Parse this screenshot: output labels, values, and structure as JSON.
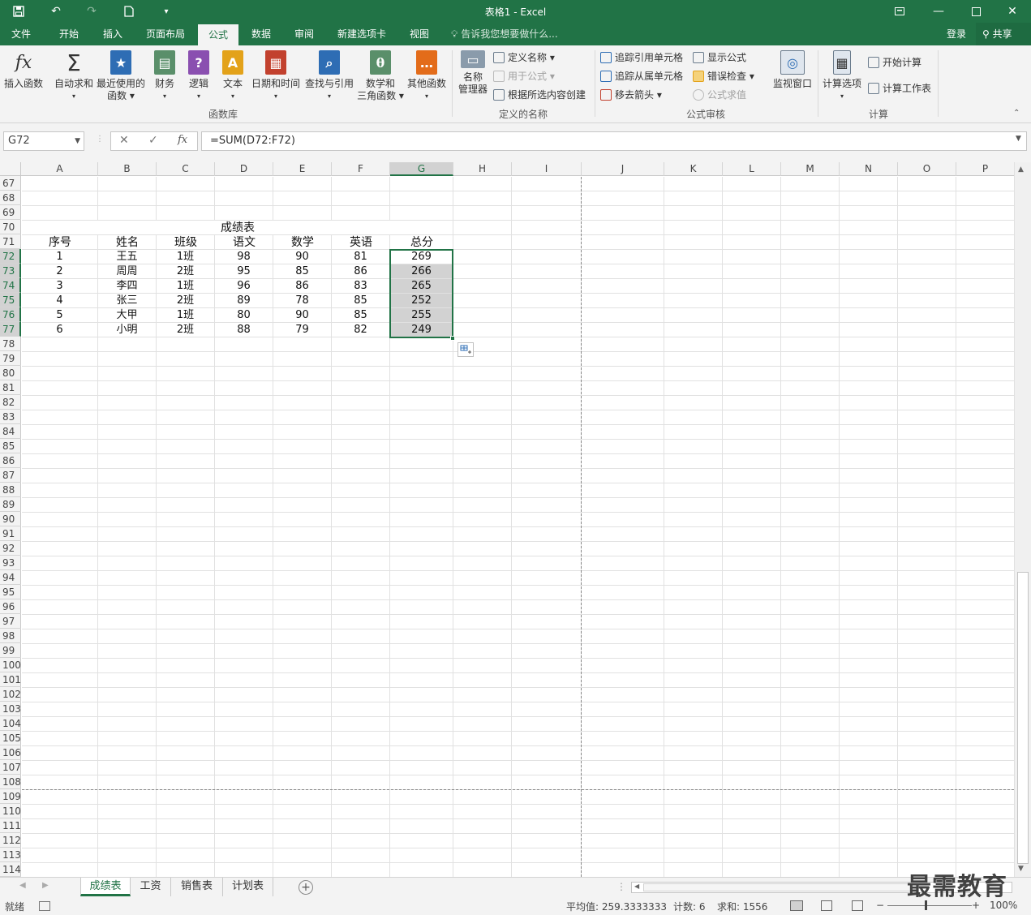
{
  "titlebar": {
    "title": "表格1 - Excel",
    "save_icon": "save-icon",
    "undo_icon": "undo-icon",
    "redo_icon": "redo-icon",
    "new_icon": "new-file-icon"
  },
  "menu": {
    "tabs": [
      "文件",
      "开始",
      "插入",
      "页面布局",
      "公式",
      "数据",
      "审阅",
      "新建选项卡",
      "视图"
    ],
    "active": "公式",
    "tell_me": "告诉我您想要做什么...",
    "login": "登录",
    "share": "共享"
  },
  "ribbon": {
    "insert_function": "插入函数",
    "autosum": "自动求和",
    "recent_1": "最近使用的",
    "recent_2": "函数",
    "financial": "财务",
    "logical": "逻辑",
    "text": "文本",
    "datetime": "日期和时间",
    "lookup": "查找与引用",
    "math_1": "数学和",
    "math_2": "三角函数",
    "more": "其他函数",
    "group_library": "函数库",
    "name_mgr_1": "名称",
    "name_mgr_2": "管理器",
    "define_name": "定义名称",
    "use_in_formula": "用于公式",
    "create_from_sel": "根据所选内容创建",
    "group_names": "定义的名称",
    "trace_precedents": "追踪引用单元格",
    "trace_dependents": "追踪从属单元格",
    "remove_arrows": "移去箭头",
    "show_formulas": "显示公式",
    "error_check": "错误检查",
    "evaluate": "公式求值",
    "watch_window": "监视窗口",
    "group_audit": "公式审核",
    "calc_options": "计算选项",
    "calc_now": "开始计算",
    "calc_sheet": "计算工作表",
    "group_calc": "计算"
  },
  "formula_bar": {
    "name_box": "G72",
    "cancel": "✕",
    "enter": "✓",
    "fx": "fx",
    "formula": "=SUM(D72:F72)"
  },
  "columns": [
    "A",
    "B",
    "C",
    "D",
    "E",
    "F",
    "G",
    "H",
    "I",
    "J",
    "K",
    "L",
    "M",
    "N",
    "O",
    "P"
  ],
  "selected_column": "G",
  "rows": [
    67,
    68,
    69,
    70,
    71,
    72,
    73,
    74,
    75,
    76,
    77,
    78,
    79,
    80,
    81,
    82,
    83,
    84,
    85,
    86,
    87,
    88,
    89,
    90,
    91,
    92,
    93,
    94,
    95,
    96,
    97,
    98,
    99,
    100,
    101,
    102,
    103,
    104,
    105,
    106,
    107,
    108,
    109,
    110,
    111,
    112,
    113,
    114
  ],
  "selected_rows": [
    72,
    73,
    74,
    75,
    76,
    77
  ],
  "table": {
    "title": "成绩表",
    "headers": [
      "序号",
      "姓名",
      "班级",
      "语文",
      "数学",
      "英语",
      "总分"
    ],
    "rows": [
      [
        "1",
        "王五",
        "1班",
        "98",
        "90",
        "81",
        "269"
      ],
      [
        "2",
        "周周",
        "2班",
        "95",
        "85",
        "86",
        "266"
      ],
      [
        "3",
        "李四",
        "1班",
        "96",
        "86",
        "83",
        "265"
      ],
      [
        "4",
        "张三",
        "2班",
        "89",
        "78",
        "85",
        "252"
      ],
      [
        "5",
        "大甲",
        "1班",
        "80",
        "90",
        "85",
        "255"
      ],
      [
        "6",
        "小明",
        "2班",
        "88",
        "79",
        "82",
        "249"
      ]
    ]
  },
  "sheets": [
    "成绩表",
    "工资",
    "销售表",
    "计划表"
  ],
  "active_sheet": "成绩表",
  "status": {
    "ready": "就绪",
    "average": "平均值: 259.3333333",
    "count": "计数: 6",
    "sum": "求和: 1556",
    "zoom": "100%"
  },
  "watermark": "最需教育",
  "colors": {
    "accent": "#217346",
    "selection_fill": "#d2d2d2"
  }
}
